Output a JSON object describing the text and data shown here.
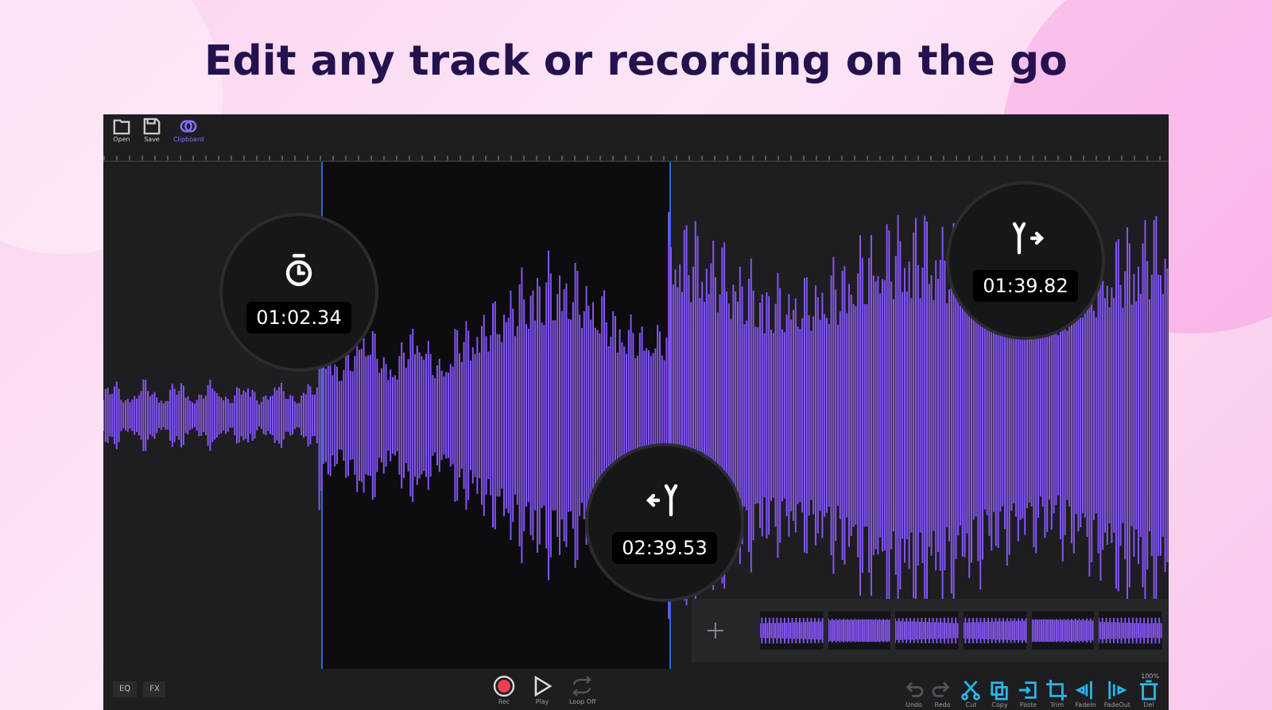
{
  "heading": "Edit any track or recording on the go",
  "toolbar": {
    "items": [
      {
        "label": "Open",
        "kind": "open",
        "selected": false
      },
      {
        "label": "Save",
        "kind": "save",
        "selected": false
      },
      {
        "label": "Clipboard",
        "kind": "clipboard",
        "selected": true
      }
    ]
  },
  "markers": [
    {
      "kind": "timer",
      "time": "01:02.34"
    },
    {
      "kind": "split-right",
      "time": "01:39.82"
    },
    {
      "kind": "split-left",
      "time": "02:39.53"
    }
  ],
  "bottom_bar": {
    "left_buttons": [
      "EQ",
      "FX"
    ],
    "transport": [
      {
        "kind": "rec",
        "label": "Rec",
        "disabled": false
      },
      {
        "kind": "play",
        "label": "Play",
        "disabled": false
      },
      {
        "kind": "loop",
        "label": "Loop Off",
        "disabled": true
      }
    ],
    "zoom": "100%",
    "tools": [
      {
        "kind": "undo",
        "label": "Undo",
        "disabled": true
      },
      {
        "kind": "redo",
        "label": "Redo",
        "disabled": true
      },
      {
        "kind": "cut",
        "label": "Cut",
        "disabled": false
      },
      {
        "kind": "copy",
        "label": "Copy",
        "disabled": false
      },
      {
        "kind": "paste",
        "label": "Paste",
        "disabled": false
      },
      {
        "kind": "trim",
        "label": "Trim",
        "disabled": false
      },
      {
        "kind": "fadein",
        "label": "FadeIn",
        "disabled": false
      },
      {
        "kind": "fadeout",
        "label": "FadeOut",
        "disabled": false
      },
      {
        "kind": "del",
        "label": "Del",
        "disabled": false
      }
    ]
  }
}
